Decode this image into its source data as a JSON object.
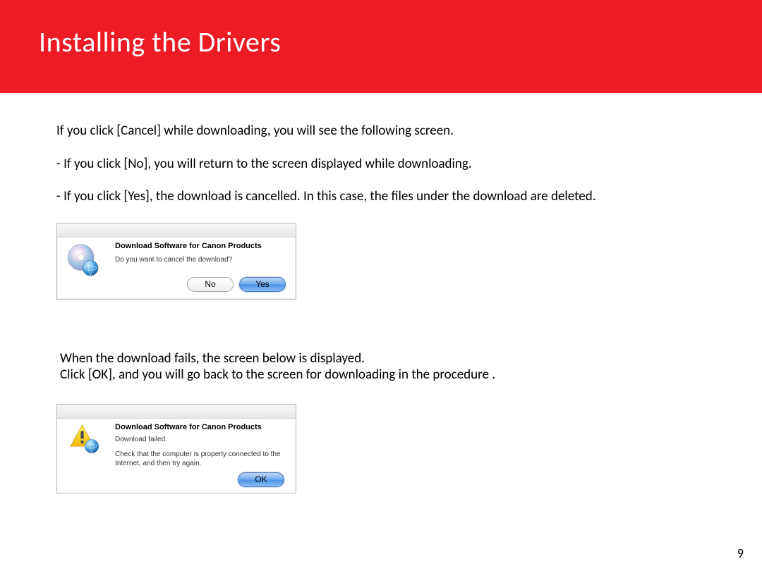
{
  "header": {
    "title": "Installing  the Drivers"
  },
  "body": {
    "p1": "If you click [Cancel] while downloading, you will see the following screen.",
    "p2": "- If you click [No], you will return to the screen displayed while downloading.",
    "p3": "- If you click [Yes], the download is cancelled. In this case, the files under the download are deleted.",
    "p4": "When the download fails, the screen below is displayed.",
    "p5": "Click [OK], and you will go back to the screen for downloading in the procedure ."
  },
  "dialog1": {
    "title": "Download Software for Canon Products",
    "message": "Do you want to cancel the download?",
    "no_label": "No",
    "yes_label": "Yes"
  },
  "dialog2": {
    "title": "Download Software for Canon Products",
    "line1": "Download failed.",
    "line2": "Check that the computer is properly connected to the Internet, and then try again.",
    "ok_label": "OK"
  },
  "page_number": "9"
}
